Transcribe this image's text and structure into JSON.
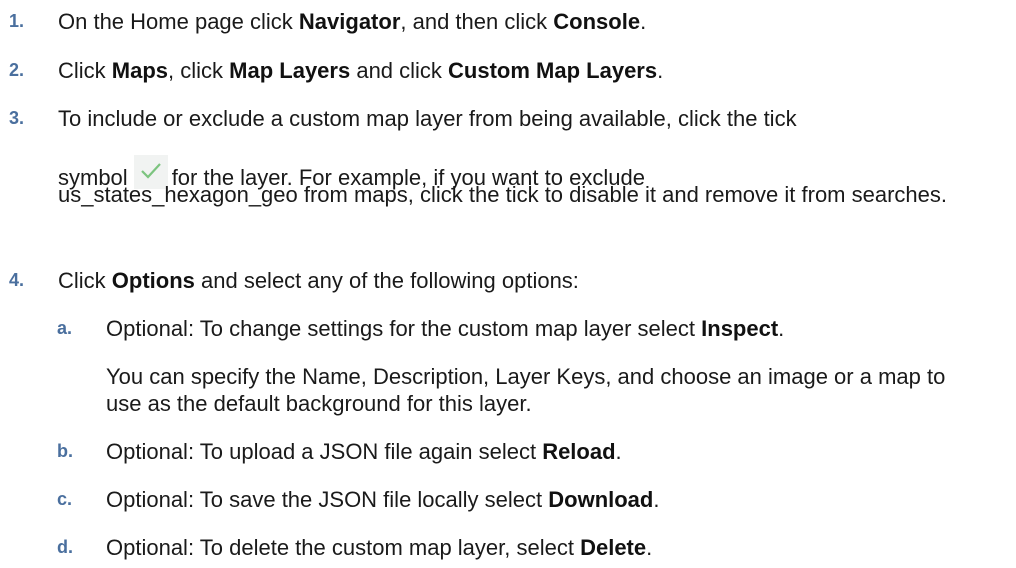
{
  "steps": [
    {
      "num": "1.",
      "parts": [
        "On the Home page click ",
        "Navigator",
        ", and then click ",
        "Console",
        "."
      ]
    },
    {
      "num": "2.",
      "parts": [
        "Click ",
        "Maps",
        ", click ",
        "Map Layers",
        " and click ",
        "Custom Map Layers",
        "."
      ]
    },
    {
      "num": "3.",
      "line1": "To include or exclude a custom map layer from being available, click the tick",
      "line2a": "symbol",
      "line2b": "for the layer. For example, if you want to exclude",
      "rest": "us_states_hexagon_geo from maps, click the tick to disable it and remove it from searches."
    },
    {
      "num": "4.",
      "parts": [
        "Click ",
        "Options",
        " and select any of the following options:"
      ]
    }
  ],
  "substeps": [
    {
      "num": "a.",
      "parts": [
        "Optional: To change settings for the custom map layer select ",
        "Inspect",
        "."
      ],
      "note": "You can specify the Name, Description, Layer Keys, and choose an image or a map to use as the default background for this layer."
    },
    {
      "num": "b.",
      "parts": [
        "Optional: To upload a JSON file again select ",
        "Reload",
        "."
      ]
    },
    {
      "num": "c.",
      "parts": [
        "Optional: To save the JSON file locally select ",
        "Download",
        "."
      ]
    },
    {
      "num": "d.",
      "parts": [
        "Optional: To delete the custom map layer, select ",
        "Delete",
        "."
      ]
    }
  ],
  "icons": {
    "tick": "checkmark-icon",
    "tick_color": "#7cc47f"
  }
}
